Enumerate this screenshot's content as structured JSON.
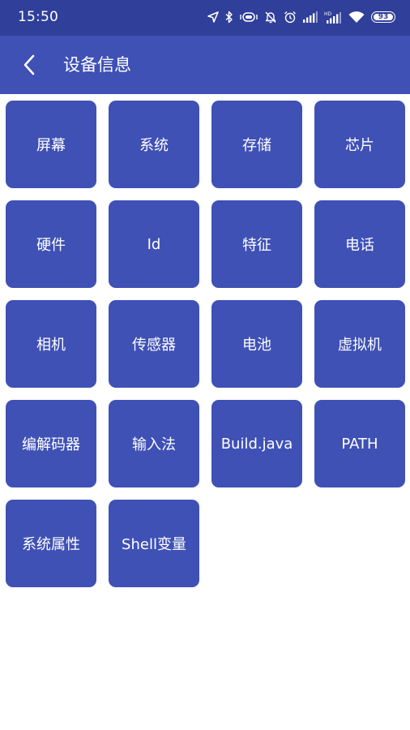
{
  "status_bar": {
    "time": "15:50",
    "battery": "93",
    "icons": [
      "location-icon",
      "bluetooth-icon",
      "vibrate-icon",
      "mute-alarm-icon",
      "alarm-icon",
      "signal-icon",
      "signal-hd-icon",
      "wifi-icon",
      "battery-icon"
    ]
  },
  "app_bar": {
    "title": "设备信息",
    "back_icon": "back-arrow-icon"
  },
  "tiles": [
    {
      "label": "屏幕"
    },
    {
      "label": "系统"
    },
    {
      "label": "存储"
    },
    {
      "label": "芯片"
    },
    {
      "label": "硬件"
    },
    {
      "label": "Id"
    },
    {
      "label": "特征"
    },
    {
      "label": "电话"
    },
    {
      "label": "相机"
    },
    {
      "label": "传感器"
    },
    {
      "label": "电池"
    },
    {
      "label": "虚拟机"
    },
    {
      "label": "编解码器"
    },
    {
      "label": "输入法"
    },
    {
      "label": "Build.java"
    },
    {
      "label": "PATH"
    },
    {
      "label": "系统属性"
    },
    {
      "label": "Shell变量"
    }
  ],
  "colors": {
    "status_bar": "#2f3f9a",
    "primary": "#3f51b5",
    "text_on_primary": "#ffffff",
    "background": "#ffffff"
  }
}
